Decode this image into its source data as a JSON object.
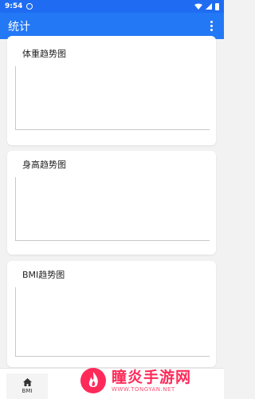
{
  "status_bar": {
    "time": "9:54"
  },
  "app_bar": {
    "title": "统计"
  },
  "charts": [
    {
      "title": "体重趋势图"
    },
    {
      "title": "身高趋势图"
    },
    {
      "title": "BMI趋势图"
    }
  ],
  "bottom_nav": {
    "home_label": "BMI"
  },
  "watermark": {
    "name": "瞳炎手游网",
    "url": "WWW.TONGYAN.NET"
  },
  "colors": {
    "status_bar": "#1f6cf2",
    "app_bar": "#2378f6",
    "background": "#f2f2f2",
    "watermark": "#ff2a59"
  }
}
